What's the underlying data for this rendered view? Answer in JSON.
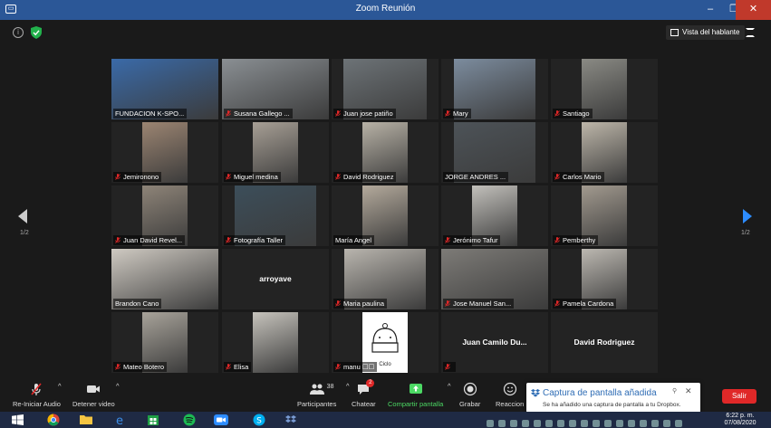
{
  "window": {
    "title": "Zoom Reunión",
    "minimize": "–",
    "maximize": "❐",
    "close": "✕"
  },
  "topbar": {
    "info_glyph": "i",
    "speaker_view_label": "Vista del hablante"
  },
  "participants": [
    {
      "name": "FUNDACION K-SPO...",
      "muted": false,
      "active": true
    },
    {
      "name": "Susana Gallego ...",
      "muted": true
    },
    {
      "name": "Juan jose patiño",
      "muted": true
    },
    {
      "name": "Mary",
      "muted": true
    },
    {
      "name": "Santiago",
      "muted": true
    },
    {
      "name": "Jemironono",
      "muted": true
    },
    {
      "name": "Miguel medina",
      "muted": true
    },
    {
      "name": "David Rodriguez",
      "muted": true
    },
    {
      "name": "JORGE ANDRES ...",
      "muted": false
    },
    {
      "name": "Carlos Mario",
      "muted": true
    },
    {
      "name": "Juan David Revel...",
      "muted": true
    },
    {
      "name": "Fotografía Taller",
      "muted": true
    },
    {
      "name": "María Angel",
      "muted": false
    },
    {
      "name": "Jerónimo Tafur",
      "muted": true
    },
    {
      "name": "Pemberthy",
      "muted": true
    },
    {
      "name": "Brandon Cano",
      "muted": false
    },
    {
      "name": "arroyave",
      "muted": false,
      "video_off": true
    },
    {
      "name": "Maria paulina",
      "muted": true
    },
    {
      "name": "Jose Manuel San...",
      "muted": true
    },
    {
      "name": "Pamela Cardona",
      "muted": true
    },
    {
      "name": "Mateo Botero",
      "muted": true
    },
    {
      "name": "Elisa",
      "muted": true
    },
    {
      "name": "manu ☐☐",
      "muted": true,
      "drawing": true,
      "drawing_text": "Ciclo"
    },
    {
      "name": "Juan Camilo Du...",
      "muted": true,
      "video_off": true
    },
    {
      "name": "David Rodriguez",
      "muted": false,
      "video_off": true
    }
  ],
  "pagination": {
    "left": "1/2",
    "right": "1/2"
  },
  "toolbar": {
    "audio_label": "Re-Iniciar Audio",
    "video_label": "Detener video",
    "participants_label": "Participantes",
    "participants_count": "38",
    "chat_label": "Chatear",
    "chat_badge": "2",
    "share_label": "Compartir pantalla",
    "record_label": "Grabar",
    "reactions_label": "Reaccion",
    "leave_label": "Salir",
    "caret": "^"
  },
  "toast": {
    "title": "Captura de pantalla añadida",
    "body": "Se ha añadido una captura de pantalla a tu Dropbox.",
    "pin": "⚲",
    "close": "✕"
  },
  "taskbar": {
    "time": "6:22 p. m.",
    "date": "07/08/2020"
  },
  "colors": {
    "titlebar": "#2b5797",
    "active_speaker": "#d6e24b",
    "share_green": "#4cd964",
    "leave_red": "#e02828",
    "muted_red": "#e02828"
  }
}
